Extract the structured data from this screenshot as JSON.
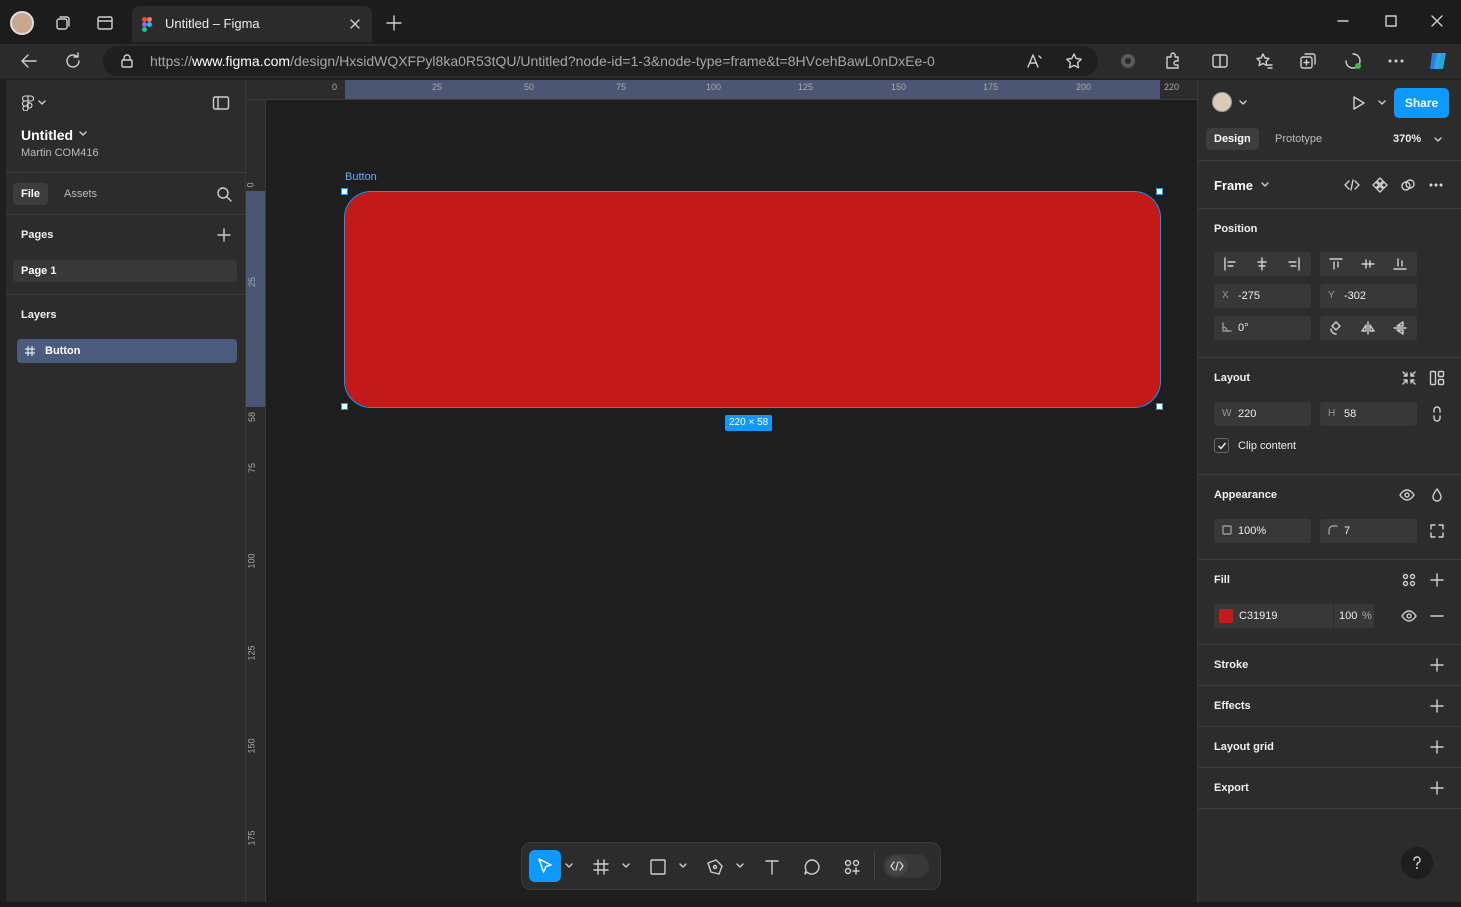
{
  "browser": {
    "tab_title": "Untitled – Figma",
    "url_prefix": "https://",
    "url_domain": "www.figma.com",
    "url_path": "/design/HxsidWQXFPyl8ka0R53tQU/Untitled?node-id=1-3&node-type=frame&t=8HVcehBawL0nDxEe-0"
  },
  "left_panel": {
    "file_name": "Untitled",
    "team_name": "Martin COM416",
    "tab_file": "File",
    "tab_assets": "Assets",
    "pages_title": "Pages",
    "page_item": "Page 1",
    "layers_title": "Layers",
    "layer_item": "Button"
  },
  "canvas": {
    "frame_label": "Button",
    "frame_fill": "#C31919",
    "size_badge": "220 × 58",
    "ruler_top": [
      "0",
      "25",
      "50",
      "75",
      "100",
      "125",
      "150",
      "175",
      "200",
      "220"
    ],
    "ruler_left": [
      "0",
      "25",
      "58",
      "75",
      "100",
      "125",
      "150",
      "175"
    ]
  },
  "right_panel": {
    "share_label": "Share",
    "tab_design": "Design",
    "tab_prototype": "Prototype",
    "zoom": "370%",
    "frame_type": "Frame",
    "position_title": "Position",
    "x_label": "X",
    "x_value": "-275",
    "y_label": "Y",
    "y_value": "-302",
    "rotation": "0°",
    "layout_title": "Layout",
    "w_label": "W",
    "w_value": "220",
    "h_label": "H",
    "h_value": "58",
    "clip_content": "Clip content",
    "appearance_title": "Appearance",
    "opacity": "100%",
    "radius": "7",
    "fill_title": "Fill",
    "fill_hex": "C31919",
    "fill_opacity": "100",
    "fill_percent": "%",
    "stroke_title": "Stroke",
    "effects_title": "Effects",
    "layout_grid_title": "Layout grid",
    "export_title": "Export"
  },
  "toolbar": {
    "accent": "#0d99ff"
  }
}
